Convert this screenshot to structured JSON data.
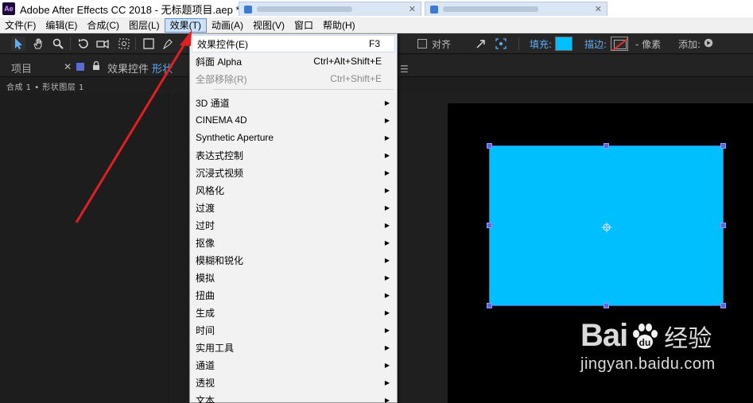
{
  "window": {
    "app_logo": "Ae",
    "title": "Adobe After Effects CC 2018 - 无标题项目.aep *"
  },
  "menubar": {
    "items": [
      "文件(F)",
      "编辑(E)",
      "合成(C)",
      "图层(L)",
      "效果(T)",
      "动画(A)",
      "视图(V)",
      "窗口",
      "帮助(H)"
    ],
    "active_index": 4
  },
  "toolbar": {
    "align_label": "对齐",
    "fill_label": "填充:",
    "fill_color": "#00bfff",
    "stroke_label": "描边:",
    "stroke_units": "- 像素",
    "add_label": "添加:"
  },
  "panels": {
    "project_tab": "项目",
    "effects_tab_prefix": "效果控件 ",
    "effects_tab_layer": "形状",
    "breadcrumb": "合成 1 • 形状图层 1"
  },
  "effect_menu": {
    "items": [
      {
        "label": "效果控件(E)",
        "shortcut": "F3",
        "submenu": false,
        "disabled": false,
        "highlighted": true
      },
      {
        "label": "斜面 Alpha",
        "shortcut": "Ctrl+Alt+Shift+E",
        "submenu": false,
        "disabled": false
      },
      {
        "label": "全部移除(R)",
        "shortcut": "Ctrl+Shift+E",
        "submenu": false,
        "disabled": true
      },
      {
        "label": "3D 通道",
        "submenu": true
      },
      {
        "label": "CINEMA 4D",
        "submenu": true
      },
      {
        "label": "Synthetic Aperture",
        "submenu": true
      },
      {
        "label": "表达式控制",
        "submenu": true
      },
      {
        "label": "沉浸式视频",
        "submenu": true
      },
      {
        "label": "风格化",
        "submenu": true
      },
      {
        "label": "过渡",
        "submenu": true
      },
      {
        "label": "过时",
        "submenu": true
      },
      {
        "label": "抠像",
        "submenu": true
      },
      {
        "label": "模糊和锐化",
        "submenu": true
      },
      {
        "label": "模拟",
        "submenu": true
      },
      {
        "label": "扭曲",
        "submenu": true
      },
      {
        "label": "生成",
        "submenu": true
      },
      {
        "label": "时间",
        "submenu": true
      },
      {
        "label": "实用工具",
        "submenu": true
      },
      {
        "label": "通道",
        "submenu": true
      },
      {
        "label": "透视",
        "submenu": true
      },
      {
        "label": "文本",
        "submenu": true
      }
    ]
  },
  "composition": {
    "shape_color": "#00bfff",
    "background": "#000000"
  },
  "watermark": {
    "brand": "Bai",
    "brand_cn": "经验",
    "url": "jingyan.baidu.com"
  },
  "annotation": {
    "arrow_color": "#e02020"
  }
}
